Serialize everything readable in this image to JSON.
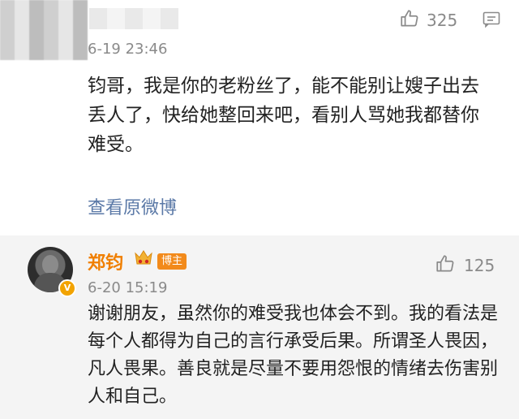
{
  "top_comment": {
    "likes": "325",
    "timestamp": "6-19 23:46",
    "text": "钧哥，我是你的老粉丝了，能不能别让嫂子出去丢人了，快给她整回来吧，看别人骂她我都替你难受。",
    "view_original_label": "查看原微博"
  },
  "reply": {
    "username": "郑钧",
    "badge_label": "博主",
    "avatar_badge": "V",
    "likes": "125",
    "timestamp": "6-20 15:19",
    "text": "谢谢朋友，虽然你的难受我也体会不到。我的看法是每个人都得为自己的言行承受后果。所谓圣人畏因，凡人畏果。善良就是尽量不要用怨恨的情绪去伤害别人和自己。"
  },
  "colors": {
    "link": "#5b79a7",
    "username": "#f07f00",
    "badge_bg": "#f28a1b",
    "muted": "#8a8a8a",
    "reply_bg": "#f4f4f4"
  },
  "icons": {
    "like": "thumbs-up-icon",
    "comment": "comment-icon",
    "crown": "crown-icon"
  }
}
